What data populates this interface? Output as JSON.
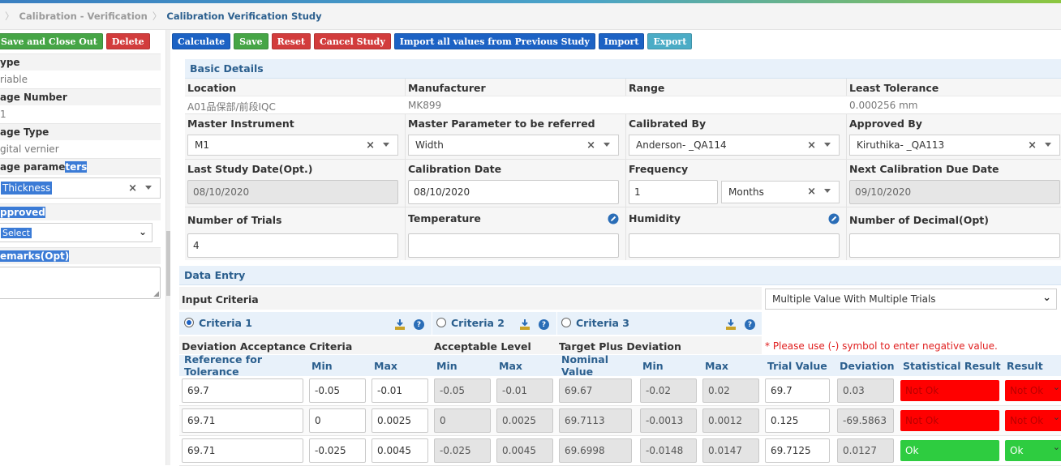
{
  "breadcrumb": {
    "parent": "Calibration - Verification",
    "current": "Calibration Verification Study"
  },
  "left": {
    "buttons": {
      "save_close": "Save and Close Out",
      "delete": "Delete"
    },
    "type_label": "ype",
    "type_value": "riable",
    "gage_number_label": "age Number",
    "gage_number_value": "1",
    "gage_type_label": "age Type",
    "gage_type_value": "gital vernier",
    "gage_params_label_a": "age parame",
    "gage_params_label_b": "ters",
    "gage_params_value": "Thickness",
    "approved_label": "pproved",
    "approved_value": "Select",
    "remarks_label": "emarks(Opt)"
  },
  "toolbar": {
    "calculate": "Calculate",
    "save": "Save",
    "reset": "Reset",
    "cancel": "Cancel Study",
    "import_prev": "Import all values from Previous Study",
    "import": "Import",
    "export": "Export"
  },
  "basic": {
    "title": "Basic Details",
    "location_label": "Location",
    "location_value": "A01品保部/前段IQC",
    "manufacturer_label": "Manufacturer",
    "manufacturer_value": "MK899",
    "range_label": "Range",
    "range_value": "",
    "least_tol_label": "Least Tolerance",
    "least_tol_value": "0.000256 mm",
    "master_inst_label": "Master Instrument",
    "master_inst_value": "M1",
    "master_param_label": "Master Parameter to be referred",
    "master_param_value": "Width",
    "calibrated_by_label": "Calibrated By",
    "calibrated_by_value": "Anderson- _QA114",
    "approved_by_label": "Approved By",
    "approved_by_value": "Kiruthika- _QA113",
    "last_study_label": "Last Study Date(Opt.)",
    "last_study_value": "08/10/2020",
    "calib_date_label": "Calibration Date",
    "calib_date_value": "08/10/2020",
    "frequency_label": "Frequency",
    "frequency_value": "1",
    "frequency_unit": "Months",
    "next_due_label": "Next Calibration Due Date",
    "next_due_value": "09/10/2020",
    "trials_label": "Number of Trials",
    "trials_value": "4",
    "temperature_label": "Temperature",
    "humidity_label": "Humidity",
    "decimal_label": "Number of Decimal(Opt)"
  },
  "data_entry": {
    "title": "Data Entry",
    "input_criteria_label": "Input Criteria",
    "input_criteria_value": "Multiple Value With Multiple Trials",
    "criteria": [
      "Criteria 1",
      "Criteria 2",
      "Criteria 3"
    ],
    "deviation_label": "Deviation Acceptance Criteria",
    "acceptable_label": "Acceptable Level",
    "target_label": "Target Plus Deviation",
    "note": "* Please use (-) symbol to enter negative value.",
    "headers": [
      "Reference for Tolerance",
      "Min",
      "Max",
      "Min",
      "Max",
      "Nominal Value",
      "Min",
      "Max",
      "Trial Value",
      "Deviation",
      "Statistical Result",
      "Result"
    ],
    "rows": [
      [
        "69.7",
        "-0.05",
        "-0.01",
        "-0.05",
        "-0.01",
        "69.67",
        "-0.02",
        "0.02",
        "69.7",
        "0.03",
        "Not Ok",
        "Not Ok"
      ],
      [
        "69.71",
        "0",
        "0.0025",
        "0",
        "0.0025",
        "69.7113",
        "-0.0013",
        "0.0012",
        "0.125",
        "-69.5863",
        "Not Ok",
        "Not Ok"
      ],
      [
        "69.71",
        "-0.025",
        "0.0045",
        "-0.025",
        "0.0045",
        "69.6998",
        "-0.0148",
        "0.0147",
        "69.7125",
        "0.0127",
        "Ok",
        "Ok"
      ]
    ]
  },
  "colors": {
    "accent": "#1c62c4",
    "save": "#46a546",
    "danger": "#d23c3c",
    "export": "#4bacc6",
    "ok": "#2ecc40",
    "not_ok": "#ff0000"
  }
}
